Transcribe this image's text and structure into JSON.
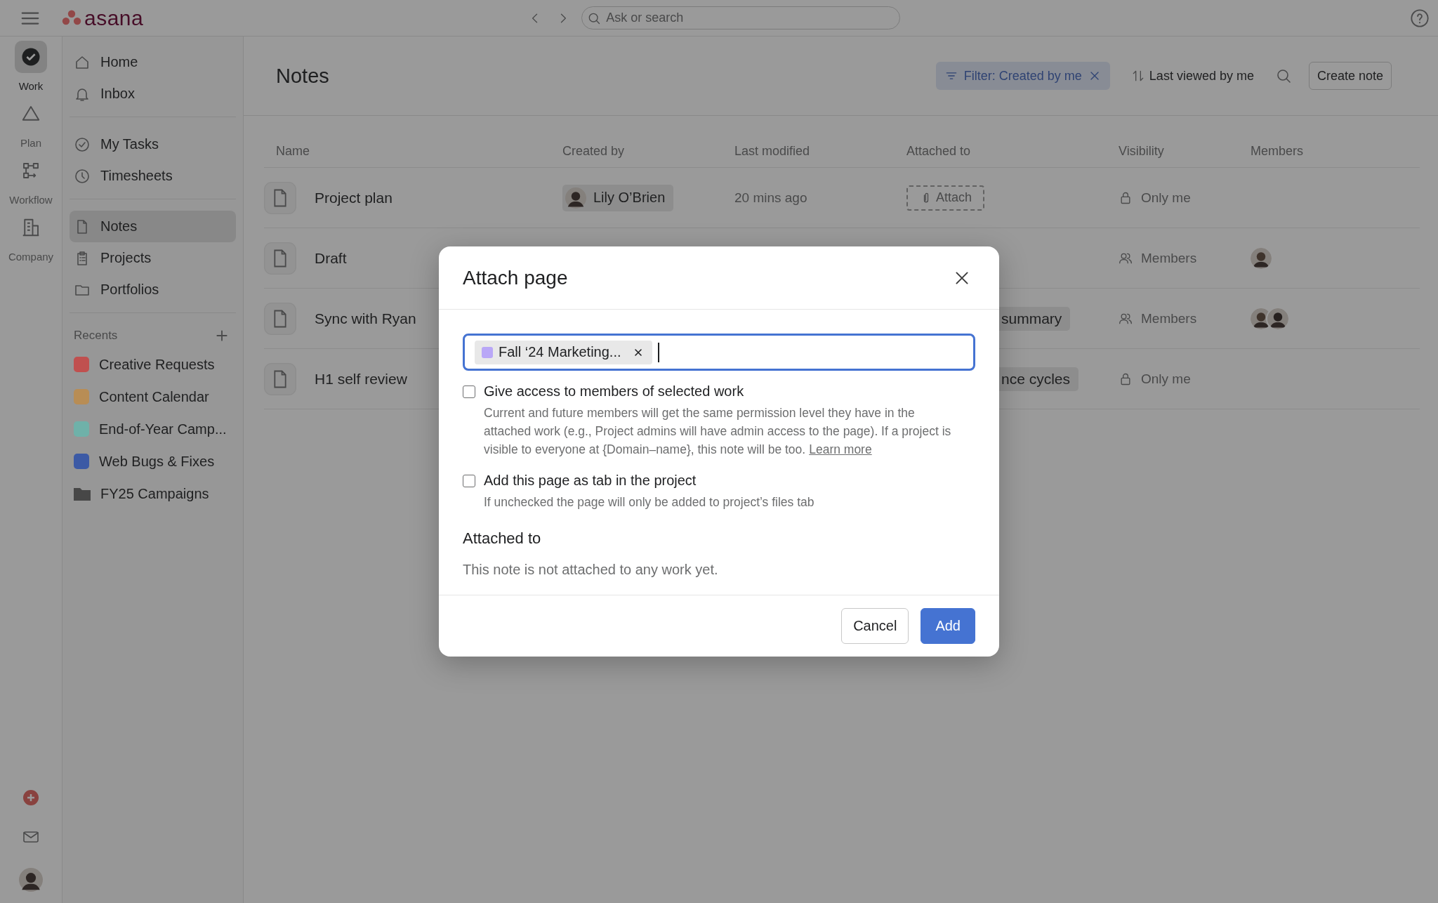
{
  "topbar": {
    "logo": "asana",
    "search": {
      "placeholder": "Ask or search"
    }
  },
  "rail": {
    "items": [
      {
        "label": "Work",
        "selected": true
      },
      {
        "label": "Plan",
        "selected": false
      },
      {
        "label": "Workflow",
        "selected": false
      },
      {
        "label": "Company",
        "selected": false
      }
    ]
  },
  "sidebar": {
    "groups": [
      {
        "items": [
          {
            "label": "Home",
            "selected": false
          },
          {
            "label": "Inbox",
            "selected": false
          }
        ]
      },
      {
        "items": [
          {
            "label": "My Tasks",
            "selected": false
          },
          {
            "label": "Timesheets",
            "selected": false
          }
        ]
      },
      {
        "items": [
          {
            "label": "Notes",
            "selected": true
          },
          {
            "label": "Projects",
            "selected": false
          },
          {
            "label": "Portfolios",
            "selected": false
          }
        ]
      }
    ],
    "recents": {
      "title": "Recents",
      "items": [
        {
          "label": "Creative Requests",
          "kind": "project",
          "color": "#c0504f"
        },
        {
          "label": "Content Calendar",
          "kind": "project",
          "color": "#b88d55"
        },
        {
          "label": "End-of-Year Camp...",
          "kind": "project",
          "color": "#6fb1a9"
        },
        {
          "label": "Web Bugs & Fixes",
          "kind": "project",
          "color": "#3c5aa5"
        },
        {
          "label": "FY25 Campaigns",
          "kind": "portfolio",
          "color": "#474747"
        }
      ]
    }
  },
  "page": {
    "title": "Notes",
    "filter": "Filter: Created by me",
    "sort": "Last viewed by me",
    "create_button": "Create note"
  },
  "table": {
    "columns": [
      "Name",
      "Created by",
      "Last modified",
      "Attached to",
      "Visibility",
      "Members"
    ],
    "rows": [
      {
        "name": "Project plan",
        "created_by": "Lily O’Brien",
        "modified": "20 mins ago",
        "attached": {
          "kind": "attach",
          "label": "Attach"
        },
        "private": true,
        "visibility": "Only me"
      },
      {
        "name": "Draft",
        "private": false,
        "visibility": "Members"
      },
      {
        "name": "Sync with Ryan",
        "attached": {
          "kind": "tag",
          "label": "summary"
        },
        "private": false,
        "visibility": "Members"
      },
      {
        "name": "H1 self review",
        "attached": {
          "kind": "tag",
          "label": "nce cycles"
        },
        "private": true,
        "visibility": "Only me"
      }
    ]
  },
  "dialog": {
    "title": "Attach page",
    "field": {
      "tags": [
        {
          "label": "Fall ‘24 Marketing...",
          "color": "#b9a7f7"
        }
      ]
    },
    "options": [
      {
        "label": "Give access to members of selected work",
        "checked": false,
        "description": "Current and future members will get the same permission level they have in the attached work (e.g., Project admins will have admin access to the page). If a project is visible to everyone at {Domain–name}, this note will be too.",
        "link": "Learn more"
      },
      {
        "label": "Add this page as tab in the project",
        "checked": false,
        "description": "If unchecked the page will only be added to project’s files tab"
      }
    ],
    "section_title": "Attached to",
    "empty_text": "This note is not attached to any work yet.",
    "buttons": [
      {
        "label": "Cancel",
        "kind": "secondary"
      },
      {
        "label": "Add",
        "kind": "primary"
      }
    ]
  }
}
